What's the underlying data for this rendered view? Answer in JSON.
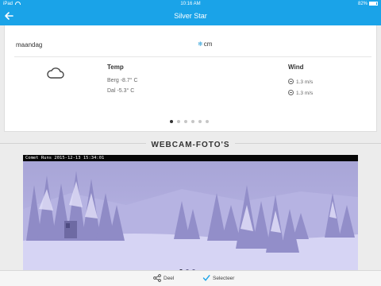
{
  "status_bar": {
    "device": "iPad",
    "time": "10:16 AM",
    "battery": "82%"
  },
  "nav": {
    "title": "Silver Star"
  },
  "forecast": {
    "day": "maandag",
    "snow_unit": "cm",
    "temp_heading": "Temp",
    "temp_mountain": "Berg -8.7° C",
    "temp_valley": "Dal -5.3° C",
    "wind_heading": "Wind",
    "wind_mountain": "1.3 m/s",
    "wind_valley": "1.3 m/s",
    "page_count": 6,
    "active_page": 1
  },
  "webcam": {
    "section_title": "WEBCAM-FOTO'S",
    "caption": "Comet Runs 2015-12-13 15:34:01",
    "image_count": 3,
    "active_image": 1
  },
  "toolbar": {
    "share_label": "Deel",
    "select_label": "Selecteer"
  },
  "colors": {
    "accent": "#1aa3e8",
    "snow_icon": "#2a9fd8"
  }
}
